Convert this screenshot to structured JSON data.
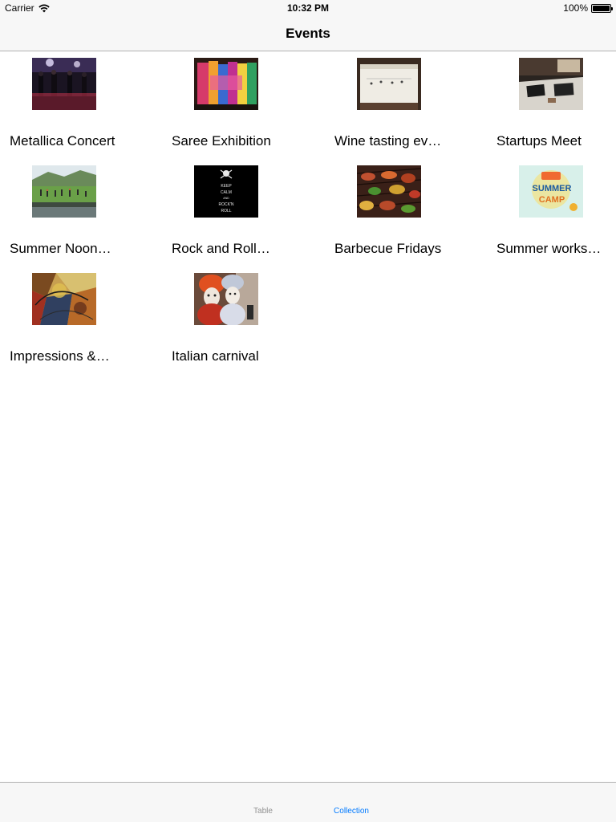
{
  "status_bar": {
    "carrier": "Carrier",
    "time": "10:32 PM",
    "battery": "100%"
  },
  "nav": {
    "title": "Events"
  },
  "events": [
    {
      "label": "Metallica Concert",
      "image": "concert-photo"
    },
    {
      "label": "Saree Exhibition",
      "image": "saree-photo"
    },
    {
      "label": "Wine tasting ev…",
      "image": "wine-photo"
    },
    {
      "label": "Startups Meet",
      "image": "startup-photo"
    },
    {
      "label": "Summer Noon…",
      "image": "field-photo"
    },
    {
      "label": "Rock and Roll…",
      "image": "keep-calm-poster"
    },
    {
      "label": "Barbecue Fridays",
      "image": "barbecue-photo"
    },
    {
      "label": "Summer works…",
      "image": "summer-camp-poster"
    },
    {
      "label": "Impressions &…",
      "image": "abstract-painting"
    },
    {
      "label": "Italian carnival",
      "image": "carnival-masks-photo"
    }
  ],
  "poster_text": {
    "keep_calm": [
      "KEEP",
      "CALM",
      "AND",
      "ROCK'N",
      "ROLL"
    ],
    "summer_camp": [
      "SUMMER",
      "CAMP"
    ]
  },
  "tabs": [
    {
      "label": "Table",
      "selected": false
    },
    {
      "label": "Collection",
      "selected": true
    }
  ],
  "colors": {
    "bar_bg": "#f7f7f7",
    "tab_selected": "#007aff",
    "tab_unselected": "#929292"
  }
}
